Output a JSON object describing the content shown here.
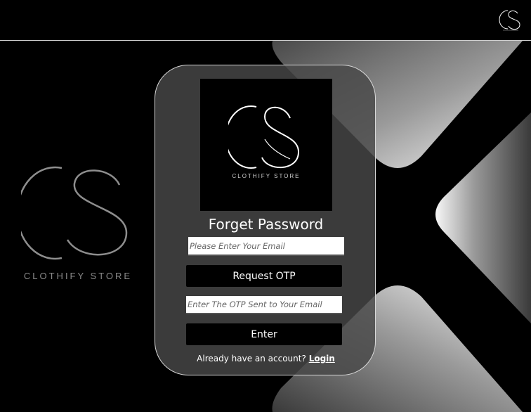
{
  "header": {
    "logo_icon": "clothify-store-monogram-icon"
  },
  "brand": {
    "monogram": "CS",
    "name": "CLOTHIFY STORE"
  },
  "form": {
    "title": "Forget Password",
    "email_placeholder": "Please Enter Your Email",
    "request_otp_label": "Request OTP",
    "otp_placeholder": "Enter The OTP Sent to Your Email",
    "enter_label": "Enter",
    "account_prompt": "Already have an account?",
    "login_link": "Login"
  },
  "colors": {
    "background": "#000000",
    "card": "#484848",
    "card_border": "#d8d8d8",
    "button": "#000000",
    "accent_text": "#ffffff"
  }
}
